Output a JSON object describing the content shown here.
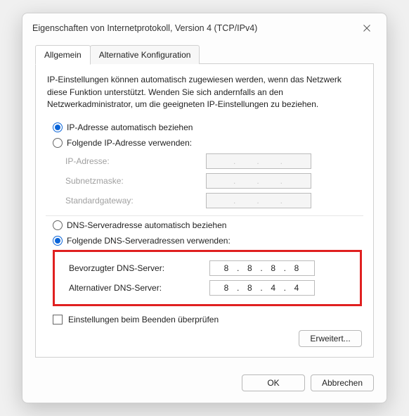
{
  "title": "Eigenschaften von Internetprotokoll, Version 4 (TCP/IPv4)",
  "tabs": {
    "general": "Allgemein",
    "alt": "Alternative Konfiguration"
  },
  "description": "IP-Einstellungen können automatisch zugewiesen werden, wenn das Netzwerk diese Funktion unterstützt. Wenden Sie sich andernfalls an den Netzwerkadministrator, um die geeigneten IP-Einstellungen zu beziehen.",
  "ip": {
    "auto_label": "IP-Adresse automatisch beziehen",
    "manual_label": "Folgende IP-Adresse verwenden:",
    "auto_selected": true,
    "fields": {
      "address_label": "IP-Adresse:",
      "subnet_label": "Subnetzmaske:",
      "gateway_label": "Standardgateway:",
      "address": [
        "",
        "",
        "",
        ""
      ],
      "subnet": [
        "",
        "",
        "",
        ""
      ],
      "gateway": [
        "",
        "",
        "",
        ""
      ]
    }
  },
  "dns": {
    "auto_label": "DNS-Serveradresse automatisch beziehen",
    "manual_label": "Folgende DNS-Serveradressen verwenden:",
    "manual_selected": true,
    "fields": {
      "preferred_label": "Bevorzugter DNS-Server:",
      "alternate_label": "Alternativer DNS-Server:",
      "preferred": [
        "8",
        "8",
        "8",
        "8"
      ],
      "alternate": [
        "8",
        "8",
        "4",
        "4"
      ]
    }
  },
  "validate_label": "Einstellungen beim Beenden überprüfen",
  "validate_checked": false,
  "buttons": {
    "advanced": "Erweitert...",
    "ok": "OK",
    "cancel": "Abbrechen"
  }
}
